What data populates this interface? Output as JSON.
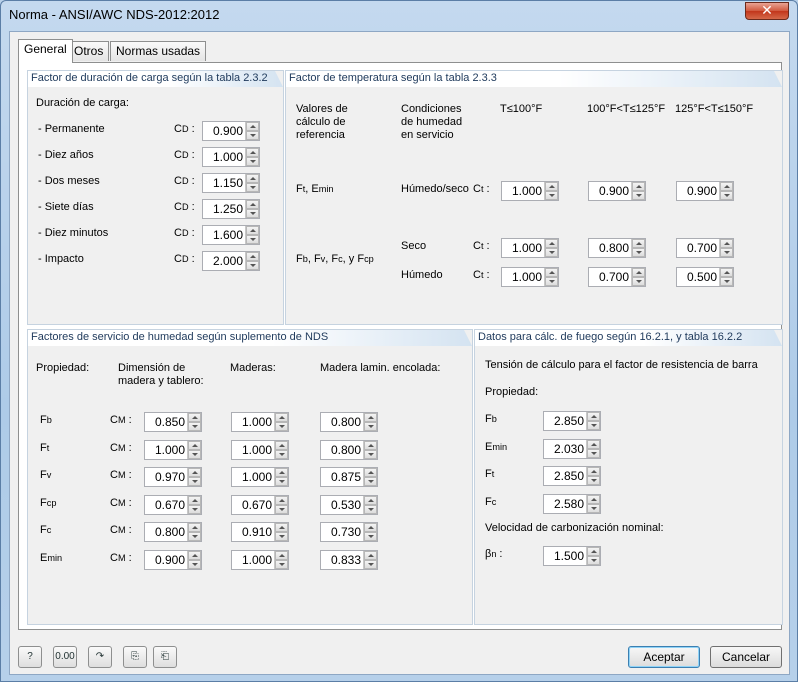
{
  "window": {
    "title": "Norma - ANSI/AWC NDS-2012:2012",
    "close": "✕"
  },
  "tabs": [
    "General",
    "Otros",
    "Normas usadas"
  ],
  "load_duration": {
    "title": "Factor de duración de carga según la tabla 2.3.2",
    "heading": "Duración de carga:",
    "rows": [
      {
        "label": "- Permanente",
        "value": "0.900"
      },
      {
        "label": "- Diez años",
        "value": "1.000"
      },
      {
        "label": "- Dos meses",
        "value": "1.150"
      },
      {
        "label": "- Siete días",
        "value": "1.250"
      },
      {
        "label": "- Diez minutos",
        "value": "1.600"
      },
      {
        "label": "- Impacto",
        "value": "2.000"
      }
    ]
  },
  "temperature": {
    "title": "Factor de temperatura según la tabla 2.3.3",
    "col_ref": "Valores de cálculo de referencia",
    "col_cond": "Condiciones de humedad en servicio",
    "col_t1": "T≤100°F",
    "col_t2": "100°F<T≤125°F",
    "col_t3": "125°F<T≤150°F",
    "row1_label": "Ft, Emin",
    "row1_cond": "Húmedo/seco",
    "row1_values": [
      "1.000",
      "0.900",
      "0.900"
    ],
    "row2_label": "Fb, Fv, Fc, y Fcp",
    "row2a_cond": "Seco",
    "row2a_values": [
      "1.000",
      "0.800",
      "0.700"
    ],
    "row2b_cond": "Húmedo",
    "row2b_values": [
      "1.000",
      "0.700",
      "0.500"
    ]
  },
  "wet_service": {
    "title": "Factores de servicio de humedad según suplemento de NDS",
    "col_prop": "Propiedad:",
    "col_dim": "Dimensión de madera y tablero:",
    "col_timber": "Maderas:",
    "col_glulam": "Madera lamin. encolada:",
    "rows": [
      {
        "prop": "Fb",
        "values": [
          "0.850",
          "1.000",
          "0.800"
        ]
      },
      {
        "prop": "Ft",
        "values": [
          "1.000",
          "1.000",
          "0.800"
        ]
      },
      {
        "prop": "Fv",
        "values": [
          "0.970",
          "1.000",
          "0.875"
        ]
      },
      {
        "prop": "Fcp",
        "values": [
          "0.670",
          "0.670",
          "0.530"
        ]
      },
      {
        "prop": "Fc",
        "values": [
          "0.800",
          "0.910",
          "0.730"
        ]
      },
      {
        "prop": "Emin",
        "values": [
          "0.900",
          "1.000",
          "0.833"
        ]
      }
    ]
  },
  "fire": {
    "title": "Datos para cálc. de fuego según 16.2.1, y tabla 16.2.2",
    "subtitle": "Tensión de cálculo para el factor de resistencia de barra",
    "prop_heading": "Propiedad:",
    "rows": [
      {
        "prop": "Fb",
        "value": "2.850"
      },
      {
        "prop": "Emin",
        "value": "2.030"
      },
      {
        "prop": "Ft",
        "value": "2.850"
      },
      {
        "prop": "Fc",
        "value": "2.580"
      }
    ],
    "char_heading": "Velocidad de carbonización nominal:",
    "char_value": "1.500"
  },
  "buttons": {
    "ok": "Aceptar",
    "cancel": "Cancelar",
    "units": "0.00"
  }
}
